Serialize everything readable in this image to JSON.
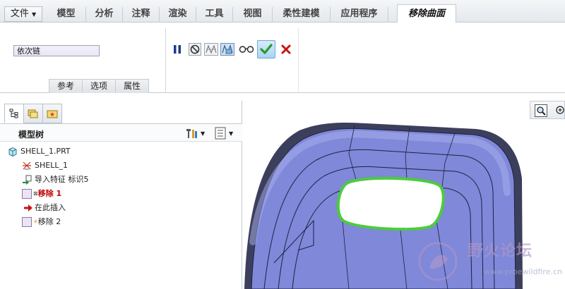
{
  "ribbon": {
    "file_label": "文件",
    "tabs": [
      "模型",
      "分析",
      "注释",
      "渲染",
      "工具",
      "视图",
      "柔性建模",
      "应用程序"
    ],
    "active_tab": "移除曲面",
    "chain_value": "依次链",
    "subtabs": [
      "参考",
      "选项",
      "属性"
    ],
    "tools": [
      "pause-icon",
      "no-preview-icon",
      "preview-mesh-icon",
      "verify-icon",
      "glasses-icon",
      "checkmark-icon",
      "cancel-x-icon"
    ]
  },
  "panel": {
    "tabs": [
      "model-tree-icon",
      "folder-browser-icon",
      "favorites-icon"
    ],
    "title": "模型树",
    "tree": [
      {
        "label": "SHELL_1.PRT",
        "icon": "part-icon"
      },
      {
        "label": "SHELL_1",
        "icon": "coordinate-system-icon"
      },
      {
        "label": "导入特征 标识5",
        "icon": "import-feature-icon"
      },
      {
        "label": "移除 1",
        "icon": "remove-feature-icon",
        "active": true
      },
      {
        "label": "在此插入",
        "icon": "insert-here-arrow-icon"
      },
      {
        "label": "移除 2",
        "icon": "remove-feature-icon"
      }
    ]
  },
  "watermark": {
    "text": "野火论坛",
    "url": "www.proewildfire.cn"
  },
  "colors": {
    "accent": "#c00000",
    "surface": "#7f88d9",
    "edge_highlight": "#4ccc3a",
    "confirm": "#2a9a2a"
  }
}
